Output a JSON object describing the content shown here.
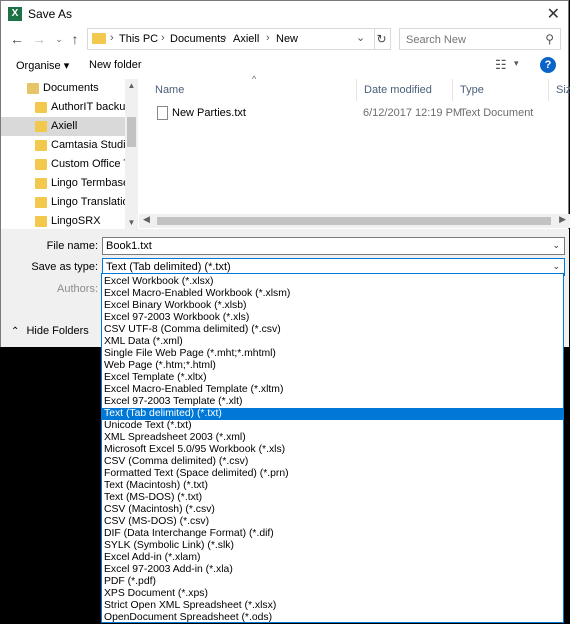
{
  "window": {
    "title": "Save As",
    "app_icon": "excel-icon"
  },
  "address": {
    "crumbs": [
      "This PC",
      "Documents",
      "Axiell",
      "New"
    ]
  },
  "search": {
    "placeholder": "Search New"
  },
  "toolbar": {
    "organise": "Organise ▾",
    "new_folder": "New folder"
  },
  "nav": {
    "items": [
      "Documents",
      "AuthorIT backup",
      "Axiell",
      "Camtasia Studio",
      "Custom Office Te",
      "Lingo Termbases",
      "Lingo Translation",
      "LingoSRX"
    ],
    "selected_index": 2
  },
  "columns": {
    "name": "Name",
    "date": "Date modified",
    "type": "Type",
    "size": "Size"
  },
  "files": [
    {
      "name": "New Parties.txt",
      "date": "6/12/2017 12:19 PM",
      "type": "Text Document"
    }
  ],
  "form": {
    "file_name_label": "File name:",
    "file_name_value": "Book1.txt",
    "save_type_label": "Save as type:",
    "save_type_value": "Text (Tab delimited) (*.txt)",
    "authors_label": "Authors:"
  },
  "hide_folders": "Hide Folders",
  "save_types": [
    "Excel Workbook (*.xlsx)",
    "Excel Macro-Enabled Workbook (*.xlsm)",
    "Excel Binary Workbook (*.xlsb)",
    "Excel 97-2003 Workbook (*.xls)",
    "CSV UTF-8 (Comma delimited) (*.csv)",
    "XML Data (*.xml)",
    "Single File Web Page (*.mht;*.mhtml)",
    "Web Page (*.htm;*.html)",
    "Excel Template (*.xltx)",
    "Excel Macro-Enabled Template (*.xltm)",
    "Excel 97-2003 Template (*.xlt)",
    "Text (Tab delimited) (*.txt)",
    "Unicode Text (*.txt)",
    "XML Spreadsheet 2003 (*.xml)",
    "Microsoft Excel 5.0/95 Workbook (*.xls)",
    "CSV (Comma delimited) (*.csv)",
    "Formatted Text (Space delimited) (*.prn)",
    "Text (Macintosh) (*.txt)",
    "Text (MS-DOS) (*.txt)",
    "CSV (Macintosh) (*.csv)",
    "CSV (MS-DOS) (*.csv)",
    "DIF (Data Interchange Format) (*.dif)",
    "SYLK (Symbolic Link) (*.slk)",
    "Excel Add-in (*.xlam)",
    "Excel 97-2003 Add-in (*.xla)",
    "PDF (*.pdf)",
    "XPS Document (*.xps)",
    "Strict Open XML Spreadsheet (*.xlsx)",
    "OpenDocument Spreadsheet (*.ods)"
  ],
  "selected_save_type_index": 11,
  "colors": {
    "accent": "#0078d7",
    "folder": "#f2c94c"
  }
}
